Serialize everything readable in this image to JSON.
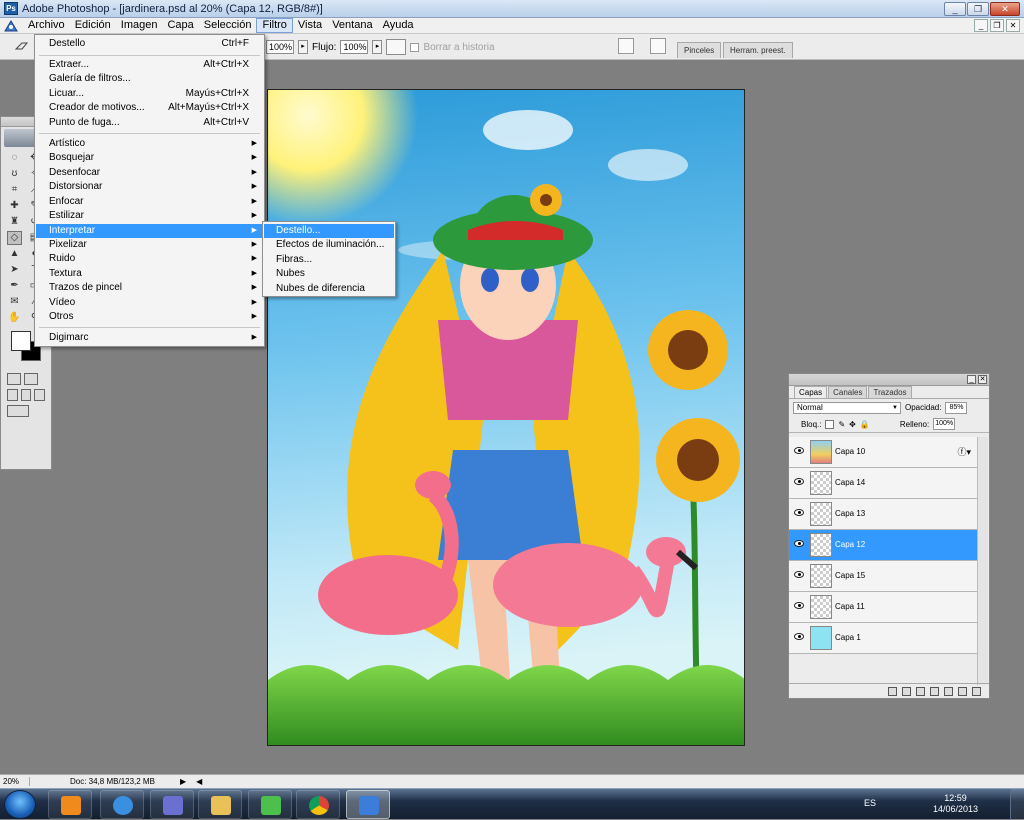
{
  "window": {
    "title": "Adobe Photoshop - [jardinera.psd al 20% (Capa 12, RGB/8#)]",
    "buttons": [
      "_",
      "❐",
      "✕"
    ]
  },
  "menubar": {
    "items": [
      "Archivo",
      "Edición",
      "Imagen",
      "Capa",
      "Selección",
      "Filtro",
      "Vista",
      "Ventana",
      "Ayuda"
    ],
    "active": "Filtro"
  },
  "options": {
    "opacity_value": "100%",
    "flow_label": "Flujo:",
    "flow_value": "100%",
    "history_label": "Borrar a historia",
    "tabs": [
      "Pinceles",
      "Herram. preest."
    ]
  },
  "filter_menu": {
    "top": [
      {
        "label": "Destello",
        "shortcut": "Ctrl+F"
      }
    ],
    "group2": [
      {
        "label": "Extraer...",
        "shortcut": "Alt+Ctrl+X"
      },
      {
        "label": "Galería de filtros...",
        "shortcut": ""
      },
      {
        "label": "Licuar...",
        "shortcut": "Mayús+Ctrl+X"
      },
      {
        "label": "Creador de motivos...",
        "shortcut": "Alt+Mayús+Ctrl+X"
      },
      {
        "label": "Punto de fuga...",
        "shortcut": "Alt+Ctrl+V"
      }
    ],
    "group3": [
      "Artístico",
      "Bosquejar",
      "Desenfocar",
      "Distorsionar",
      "Enfocar",
      "Estilizar",
      "Interpretar",
      "Pixelizar",
      "Ruido",
      "Textura",
      "Trazos de pincel",
      "Vídeo",
      "Otros"
    ],
    "highlighted": "Interpretar",
    "bottom": "Digimarc"
  },
  "submenu": {
    "items": [
      "Destello...",
      "Efectos de iluminación...",
      "Fibras...",
      "Nubes",
      "Nubes de diferencia"
    ],
    "highlighted": "Destello..."
  },
  "layers_panel": {
    "tabs": [
      "Capas",
      "Canales",
      "Trazados"
    ],
    "blend_mode": "Normal",
    "opacity_label": "Opacidad:",
    "opacity_value": "85%",
    "lock_label": "Bloq.:",
    "fill_label": "Relleno:",
    "fill_value": "100%",
    "layers": [
      {
        "name": "Capa 10",
        "thumb": "pic",
        "fx": true
      },
      {
        "name": "Capa 14",
        "thumb": "transparent"
      },
      {
        "name": "Capa 13",
        "thumb": "transparent"
      },
      {
        "name": "Capa 12",
        "thumb": "transparent",
        "selected": true
      },
      {
        "name": "Capa 15",
        "thumb": "transparent"
      },
      {
        "name": "Capa 11",
        "thumb": "transparent"
      },
      {
        "name": "Capa 1",
        "thumb": "cyan"
      }
    ]
  },
  "statusbar": {
    "zoom": "20%",
    "doc": "Doc: 34,8 MB/123,2 MB"
  },
  "taskbar": {
    "language": "ES",
    "time": "12:59",
    "date": "14/06/2013"
  },
  "colors": {
    "highlight": "#3399ff",
    "menu_bg": "#f4f4f4",
    "canvas_gray": "#7f7f7f"
  }
}
